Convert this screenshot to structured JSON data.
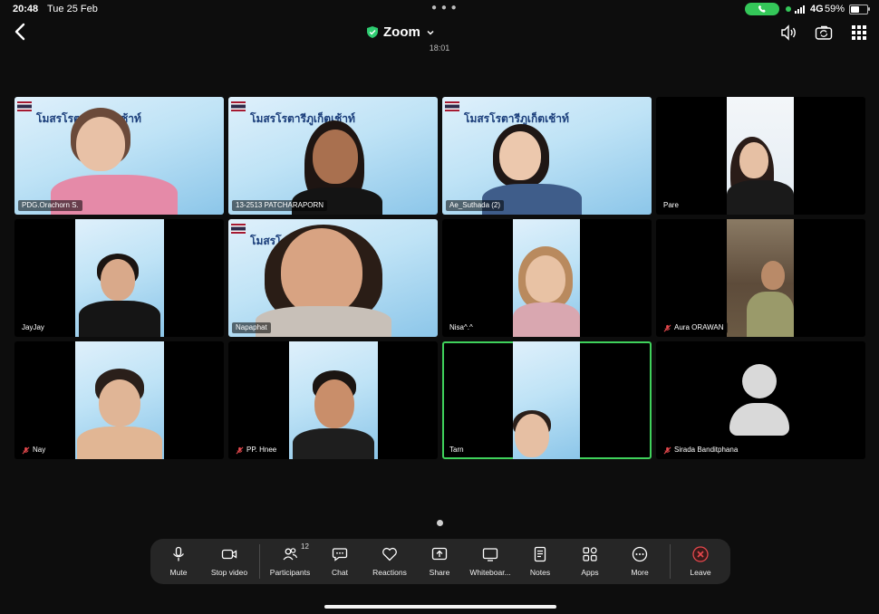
{
  "status_bar": {
    "time": "20:48",
    "date": "Tue 25 Feb",
    "network": "4G",
    "battery": "59%",
    "battery_level": 0.59,
    "call_color": "#34c759"
  },
  "header": {
    "title": "Zoom",
    "timer": "18:01",
    "secure_color": "#2ecc71"
  },
  "banner_text": "โมสรโรตารีภูเก็ตเช้าท์",
  "participants": [
    {
      "name": "PDG.Orachorn S.",
      "muted": false
    },
    {
      "name": "13-2513 PATCHARAPORN",
      "muted": false
    },
    {
      "name": "Ae_Suthada (2)",
      "muted": false
    },
    {
      "name": "Pare",
      "muted": false
    },
    {
      "name": "JayJay",
      "muted": false
    },
    {
      "name": "Napaphat",
      "muted": false
    },
    {
      "name": "Nisa^.^",
      "muted": false
    },
    {
      "name": "Aura ORAWAN",
      "muted": true
    },
    {
      "name": "Nay",
      "muted": true
    },
    {
      "name": "PP. Hnee",
      "muted": true
    },
    {
      "name": "Tarn",
      "muted": false,
      "active_speaker": true
    },
    {
      "name": "Sirada Banditphana",
      "muted": true
    }
  ],
  "toolbar": {
    "mute": "Mute",
    "stop_video": "Stop video",
    "participants": "Participants",
    "participants_count": "12",
    "chat": "Chat",
    "reactions": "Reactions",
    "share": "Share",
    "whiteboard": "Whiteboar...",
    "notes": "Notes",
    "apps": "Apps",
    "more": "More",
    "leave": "Leave",
    "leave_color": "#e5484d"
  },
  "icons": {
    "back": "chevron-left-icon",
    "speaker": "speaker-icon",
    "camera_switch": "camera-switch-icon",
    "grid": "grid-icon"
  }
}
